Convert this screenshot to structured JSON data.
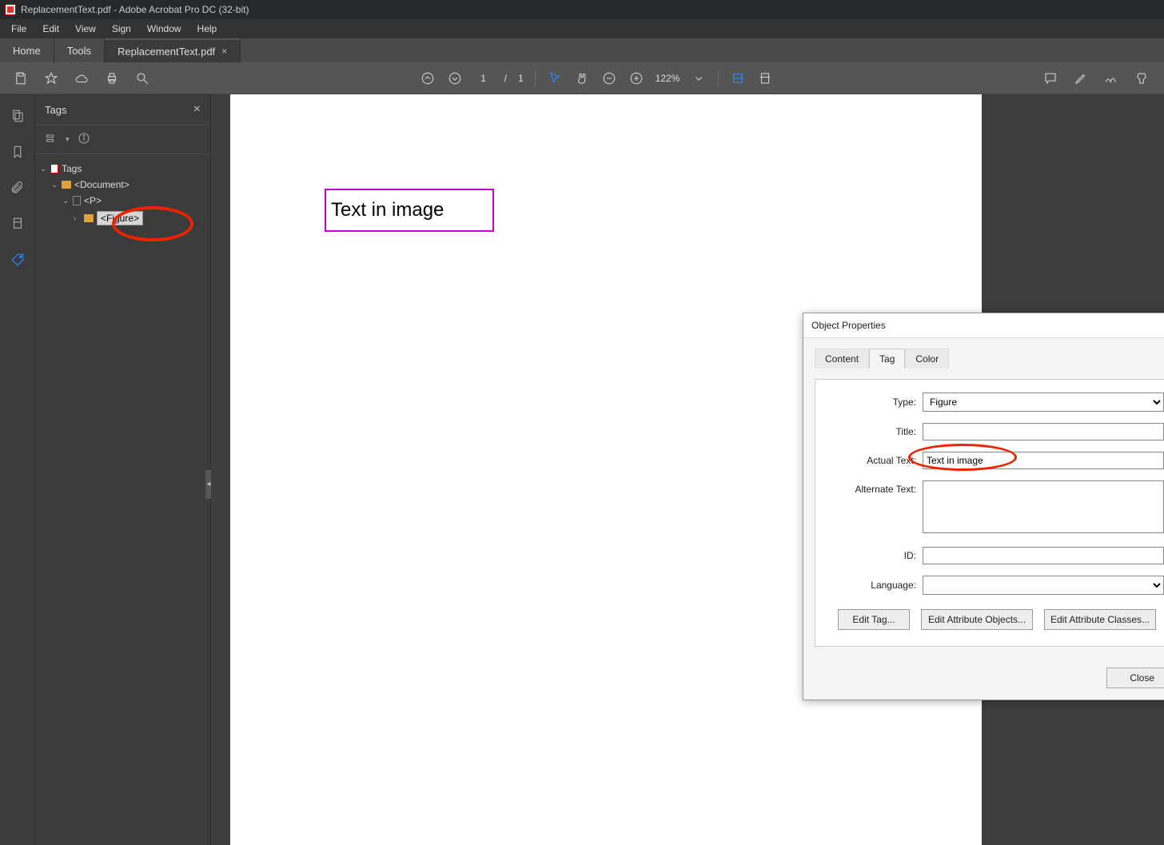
{
  "window": {
    "title": "ReplacementText.pdf - Adobe Acrobat Pro DC (32-bit)"
  },
  "menu": {
    "file": "File",
    "edit": "Edit",
    "view": "View",
    "sign": "Sign",
    "window": "Window",
    "help": "Help"
  },
  "tabs": {
    "home": "Home",
    "tools": "Tools",
    "doc": "ReplacementText.pdf"
  },
  "toolbar": {
    "page_current": "1",
    "page_sep": "/",
    "page_total": "1",
    "zoom": "122%"
  },
  "tags_panel": {
    "title": "Tags",
    "root": "Tags",
    "document": "<Document>",
    "p": "<P>",
    "figure": "<Figure>"
  },
  "page": {
    "figure_text": "Text in image"
  },
  "dialog": {
    "title": "Object Properties",
    "tabs": {
      "content": "Content",
      "tag": "Tag",
      "color": "Color"
    },
    "labels": {
      "type": "Type:",
      "title": "Title:",
      "actual": "Actual Text:",
      "alt": "Alternate Text:",
      "id": "ID:",
      "lang": "Language:"
    },
    "values": {
      "type": "Figure",
      "title": "",
      "actual": "Text in image",
      "alt": "",
      "id": "",
      "lang": ""
    },
    "buttons": {
      "edit_tag": "Edit Tag...",
      "edit_attr_obj": "Edit Attribute Objects...",
      "edit_attr_cls": "Edit Attribute Classes..."
    },
    "close": "Close"
  }
}
